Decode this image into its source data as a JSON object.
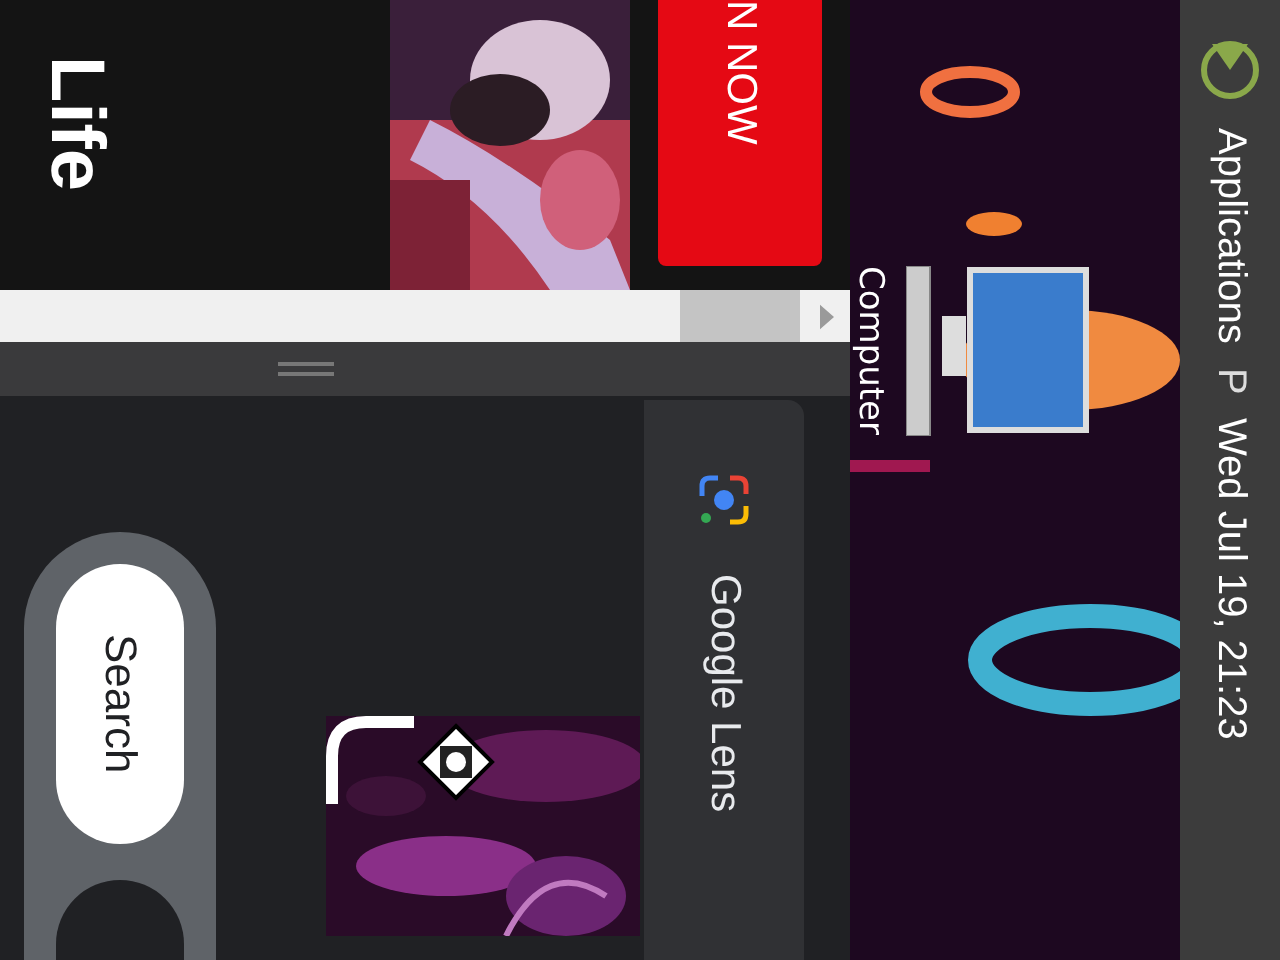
{
  "browser": {
    "ad": {
      "headline": "Life",
      "button": "N NOW"
    },
    "lens": {
      "search_button": "Search",
      "lens_label": "Google Lens"
    }
  },
  "desktop": {
    "icons": [
      {
        "label": "Computer"
      }
    ]
  },
  "top_panel": {
    "menu": "Applications",
    "indicator": "P",
    "clock": "Wed Jul 19, 21:23"
  }
}
